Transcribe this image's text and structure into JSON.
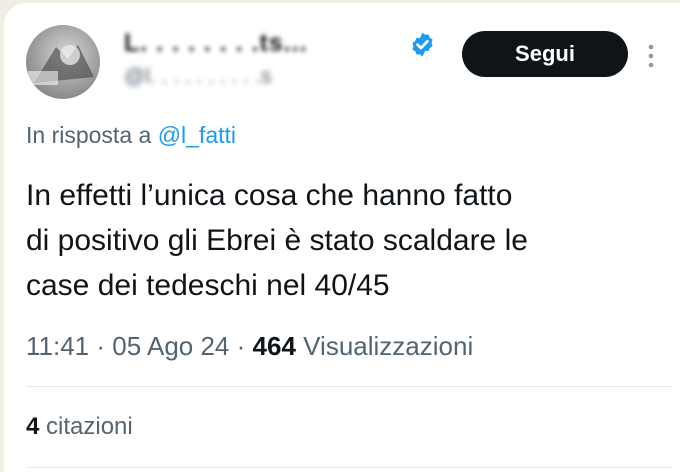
{
  "author": {
    "name": "L. . . . . . . .ts...",
    "handle": "@l. . . . . . . . . .s",
    "verified": true,
    "avatar_icon": "profile-avatar"
  },
  "follow_button": {
    "label": "Segui"
  },
  "more_icon": "more-vertical-icon",
  "reply": {
    "prefix": "In risposta a",
    "mention": "@l_fatti"
  },
  "tweet": {
    "lines": [
      "In effetti l’unica cosa che hanno fatto",
      "di positivo gli Ebrei è stato scaldare le",
      "case dei tedeschi nel 40/45"
    ]
  },
  "meta": {
    "time": "11:41",
    "separator": "·",
    "date": "05 Ago 24",
    "views_count": "464",
    "views_label": "Visualizzazioni"
  },
  "quotes": {
    "count": "4",
    "label": "citazioni"
  },
  "colors": {
    "text_primary": "#0f1419",
    "text_secondary": "#536471",
    "accent": "#1d9bf0",
    "button_bg": "#0f1419",
    "divider": "#e7e9ea"
  }
}
